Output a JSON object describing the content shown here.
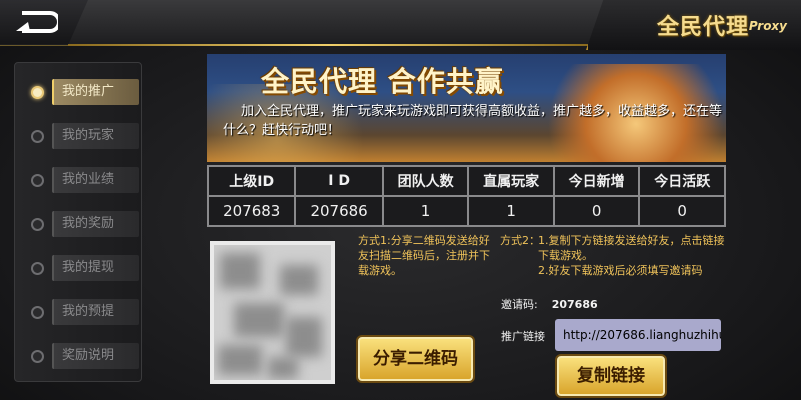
{
  "header": {
    "title": "全民代理",
    "subtitle": "Proxy",
    "back_icon": "back-arrow-icon"
  },
  "sidebar": {
    "items": [
      {
        "label": "我的推广",
        "active": true
      },
      {
        "label": "我的玩家",
        "active": false
      },
      {
        "label": "我的业绩",
        "active": false
      },
      {
        "label": "我的奖励",
        "active": false
      },
      {
        "label": "我的提现",
        "active": false
      },
      {
        "label": "我的预提",
        "active": false
      },
      {
        "label": "奖励说明",
        "active": false
      }
    ]
  },
  "banner": {
    "title": "全民代理 合作共赢",
    "text": "加入全民代理，推广玩家来玩游戏即可获得高额收益，推广越多，收益越多，还在等什么？赶快行动吧！"
  },
  "stats": {
    "headers": [
      "上级ID",
      "I D",
      "团队人数",
      "直属玩家",
      "今日新增",
      "今日活跃"
    ],
    "values": [
      "207683",
      "207686",
      "1",
      "1",
      "0",
      "0"
    ]
  },
  "share": {
    "method1": "方式1:分享二维码发送给好友扫描二维码后，注册并下载游戏。",
    "share_button": "分享二维码",
    "method2_label": "方式2：",
    "method2_lines": [
      "1.复制下方链接发送给好友，点击链接下载游戏。",
      "2.好友下载游戏后必须填写邀请码"
    ],
    "invite_label": "邀请码:",
    "invite_code": "207686",
    "link_label": "推广链接",
    "link_value": "http://207686.lianghuzhihu",
    "copy_button": "复制链接"
  },
  "colors": {
    "accent": "#f0cf6a",
    "hint": "#f0c35a"
  }
}
